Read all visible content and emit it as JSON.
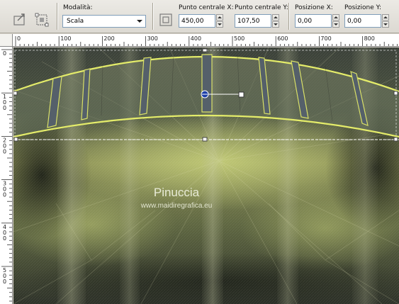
{
  "toolbar": {
    "mode_label": "Modalità:",
    "mode_value": "Scala",
    "center_x_label": "Punto centrale X:",
    "center_x_value": "450,00",
    "center_y_label": "Punto centrale Y:",
    "center_y_value": "107,50",
    "pos_x_label": "Posizione X:",
    "pos_x_value": "0,00",
    "pos_y_label": "Posizione Y:",
    "pos_y_value": "0,00"
  },
  "ruler_top": {
    "ticks": [
      "0",
      "100",
      "200",
      "300",
      "400",
      "500",
      "600",
      "700",
      "800"
    ]
  },
  "ruler_left": {
    "ticks": [
      "0",
      "100",
      "200",
      "300",
      "400",
      "500"
    ]
  },
  "canvas": {
    "watermark_title": "Pinuccia",
    "watermark_url": "www.maidiregrafica.eu"
  },
  "colors": {
    "toolbar_bg": "#dcd9d2",
    "canvas_olive": "#6f7a4e",
    "frame_yellow": "#e4ec6a",
    "handle_blue": "#1d3fa8"
  },
  "icons": [
    "pick-tool-icon",
    "deform-tool-icon",
    "center-target-icon"
  ]
}
